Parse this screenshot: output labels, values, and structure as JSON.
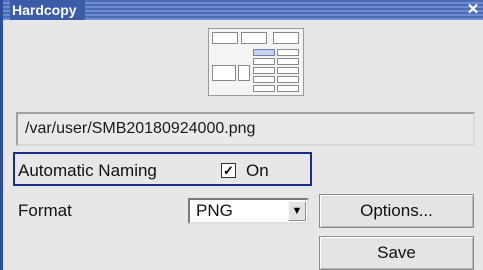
{
  "window": {
    "title": "Hardcopy",
    "close_glyph": "✕"
  },
  "preview": {
    "icon": "screenshot-thumbnail"
  },
  "file": {
    "path": "/var/user/SMB20180924000.png"
  },
  "automatic_naming": {
    "label": "Automatic Naming",
    "checked": true,
    "check_glyph": "✓",
    "option_label": "On"
  },
  "format": {
    "label": "Format",
    "selected": "PNG",
    "arrow_glyph": "▼"
  },
  "buttons": {
    "options": "Options...",
    "save": "Save"
  },
  "colors": {
    "titlebar": "#3b5ca6",
    "focus_frame": "#1b2e8a",
    "dialog_bg": "#e7e7e7"
  }
}
